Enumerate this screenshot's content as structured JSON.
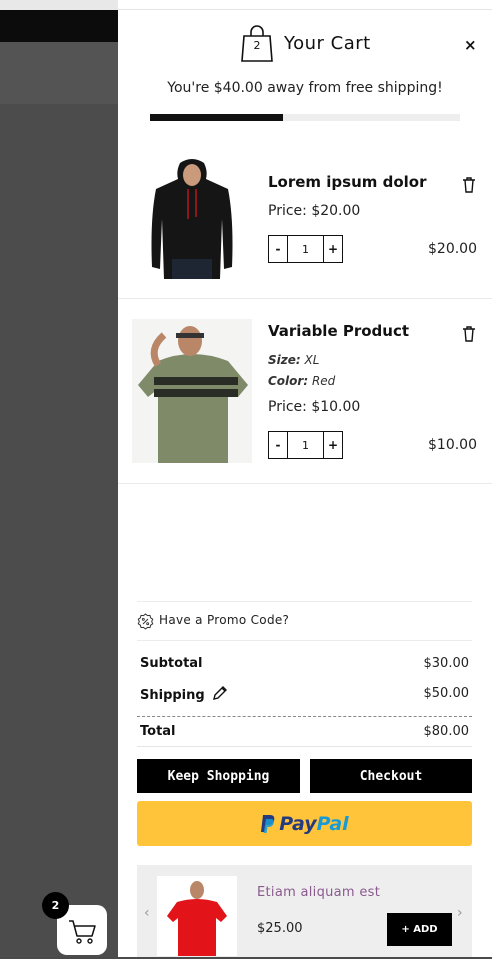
{
  "header": {
    "bag_count": "2",
    "title": "Your Cart",
    "close_label": "×"
  },
  "shipping": {
    "message": "You're $40.00 away from free shipping!",
    "progress_fraction": 0.43
  },
  "items": [
    {
      "name": "Lorem ipsum dolor",
      "price_label": "Price: $20.00",
      "qty_minus": "-",
      "qty_value": "1",
      "qty_plus": "+",
      "line_total": "$20.00",
      "image": "black-hoodie-tshirt"
    },
    {
      "name": "Variable Product",
      "size_key": "Size:",
      "size_value": "XL",
      "color_key": "Color:",
      "color_value": "Red",
      "price_label": "Price: $10.00",
      "qty_minus": "-",
      "qty_value": "1",
      "qty_plus": "+",
      "line_total": "$10.00",
      "image": "olive-striped-tshirt"
    }
  ],
  "promo": {
    "label": "Have a Promo Code?",
    "icon": "discount-icon"
  },
  "totals": {
    "subtotal_label": "Subtotal",
    "subtotal_value": "$30.00",
    "shipping_label": "Shipping",
    "shipping_value": "$50.00",
    "total_label": "Total",
    "total_value": "$80.00"
  },
  "buttons": {
    "keep_shopping": "Keep Shopping",
    "checkout": "Checkout",
    "paypal_a": "Pay",
    "paypal_b": "Pal"
  },
  "upsell": {
    "name": "Etiam aliquam est",
    "price": "$25.00",
    "add_label": "+ ADD",
    "prev_arrow": "‹",
    "next_arrow": "›",
    "image": "red-tshirt"
  },
  "floating_cart": {
    "count": "2"
  },
  "colors": {
    "accent": "#000000",
    "paypal_yellow": "#ffc439",
    "upsell_name": "#8a5a8e"
  }
}
